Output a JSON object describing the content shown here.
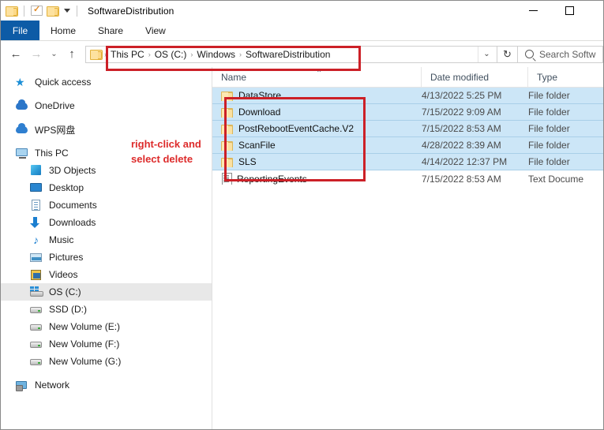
{
  "window": {
    "title": "SoftwareDistribution",
    "controls": {
      "minimize": "—",
      "maximize": "□",
      "close": "✕"
    }
  },
  "quick_access_toolbar": {
    "items": [
      {
        "name": "folder-icon",
        "label": ""
      },
      {
        "name": "properties-icon",
        "label": ""
      },
      {
        "name": "new-folder-icon",
        "label": ""
      },
      {
        "name": "customize-icon",
        "label": ""
      }
    ]
  },
  "ribbon": {
    "tabs": [
      {
        "label": "File",
        "active": true
      },
      {
        "label": "Home",
        "active": false
      },
      {
        "label": "Share",
        "active": false
      },
      {
        "label": "View",
        "active": false
      }
    ]
  },
  "address_bar": {
    "back": "←",
    "forward": "→",
    "recent": "⌄",
    "up": "↑",
    "breadcrumbs": [
      "This PC",
      "OS (C:)",
      "Windows",
      "SoftwareDistribution"
    ],
    "separator": "›",
    "dropdown": "⌄",
    "refresh": "↻"
  },
  "search": {
    "placeholder": "Search Softw"
  },
  "sidebar": {
    "items": [
      {
        "label": "Quick access",
        "icon": "star-icon",
        "level": 1,
        "selected": false
      },
      {
        "label": "OneDrive",
        "icon": "cloud-icon",
        "level": 1,
        "selected": false
      },
      {
        "label": "WPS网盘",
        "icon": "wps-cloud-icon",
        "level": 1,
        "selected": false
      },
      {
        "label": "This PC",
        "icon": "monitor-icon",
        "level": 1,
        "selected": false
      },
      {
        "label": "3D Objects",
        "icon": "cube-icon",
        "level": 2,
        "selected": false
      },
      {
        "label": "Desktop",
        "icon": "desktop-icon",
        "level": 2,
        "selected": false
      },
      {
        "label": "Documents",
        "icon": "documents-icon",
        "level": 2,
        "selected": false
      },
      {
        "label": "Downloads",
        "icon": "downloads-icon",
        "level": 2,
        "selected": false
      },
      {
        "label": "Music",
        "icon": "music-icon",
        "level": 2,
        "selected": false
      },
      {
        "label": "Pictures",
        "icon": "pictures-icon",
        "level": 2,
        "selected": false
      },
      {
        "label": "Videos",
        "icon": "videos-icon",
        "level": 2,
        "selected": false
      },
      {
        "label": "OS (C:)",
        "icon": "os-drive-icon",
        "level": 2,
        "selected": true
      },
      {
        "label": "SSD (D:)",
        "icon": "drive-icon",
        "level": 2,
        "selected": false
      },
      {
        "label": "New Volume (E:)",
        "icon": "drive-icon",
        "level": 2,
        "selected": false
      },
      {
        "label": "New Volume (F:)",
        "icon": "drive-icon",
        "level": 2,
        "selected": false
      },
      {
        "label": "New Volume (G:)",
        "icon": "drive-icon",
        "level": 2,
        "selected": false
      },
      {
        "label": "Network",
        "icon": "network-icon",
        "level": 1,
        "selected": false
      }
    ]
  },
  "file_list": {
    "columns": [
      {
        "label": "Name",
        "sorted": "asc",
        "sort_glyph": "⌃"
      },
      {
        "label": "Date modified",
        "sorted": "",
        "sort_glyph": ""
      },
      {
        "label": "Type",
        "sorted": "",
        "sort_glyph": ""
      }
    ],
    "rows": [
      {
        "name": "DataStore",
        "date": "4/13/2022 5:25 PM",
        "type": "File folder",
        "icon": "folder-icon",
        "selected": true
      },
      {
        "name": "Download",
        "date": "7/15/2022 9:09 AM",
        "type": "File folder",
        "icon": "folder-icon",
        "selected": true
      },
      {
        "name": "PostRebootEventCache.V2",
        "date": "7/15/2022 8:53 AM",
        "type": "File folder",
        "icon": "folder-icon",
        "selected": true
      },
      {
        "name": "ScanFile",
        "date": "4/28/2022 8:39 AM",
        "type": "File folder",
        "icon": "folder-icon",
        "selected": true
      },
      {
        "name": "SLS",
        "date": "4/14/2022 12:37 PM",
        "type": "File folder",
        "icon": "folder-icon",
        "selected": true
      },
      {
        "name": "ReportingEvents",
        "date": "7/15/2022 8:53 AM",
        "type": "Text Docume",
        "icon": "text-file-icon",
        "selected": false
      }
    ]
  },
  "annotations": {
    "instruction_line1": "right-click and",
    "instruction_line2": "select delete",
    "color": "#dd2b2b",
    "box_color": "#cc2027"
  }
}
